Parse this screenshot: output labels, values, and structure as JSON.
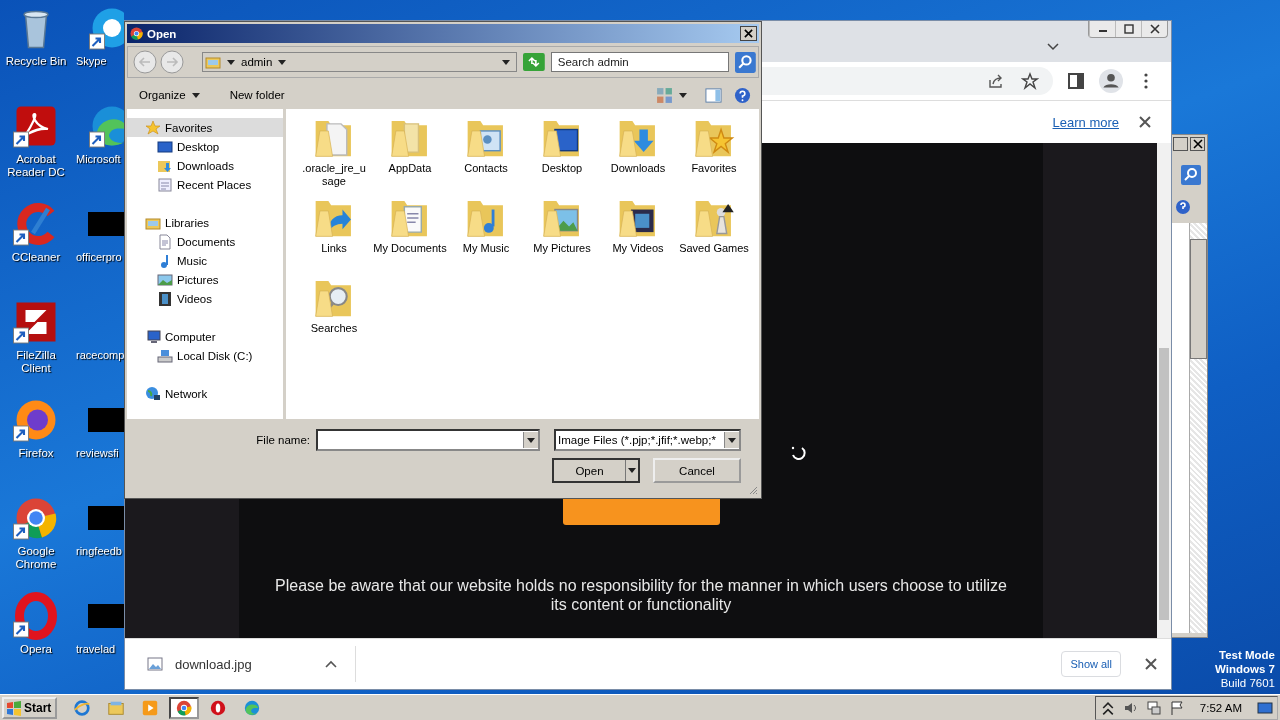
{
  "desktop": {
    "icons": [
      {
        "label": "Recycle Bin",
        "kind": "recycle"
      },
      {
        "label": "Acrobat Reader DC",
        "kind": "acrobat"
      },
      {
        "label": "CCleaner",
        "kind": "ccleaner"
      },
      {
        "label": "FileZilla Client",
        "kind": "filezilla"
      },
      {
        "label": "Firefox",
        "kind": "firefox"
      },
      {
        "label": "Google Chrome",
        "kind": "chrome"
      },
      {
        "label": "Opera",
        "kind": "opera"
      },
      {
        "label": "Skype",
        "kind": "skype"
      },
      {
        "label": "Microsoft",
        "kind": "edge"
      },
      {
        "label": "officerpro",
        "kind": "redacted"
      },
      {
        "label": "racecomp"
      },
      {
        "label": "reviewsfi",
        "kind": "redacted"
      },
      {
        "label": "ringfeedb",
        "kind": "redacted"
      },
      {
        "label": "travelad",
        "kind": "redacted"
      }
    ],
    "test_mode": [
      "Test Mode",
      "Windows 7",
      "Build 7601"
    ]
  },
  "browser": {
    "info_bar": {
      "link": "Learn more"
    },
    "page": {
      "disclaimer": "Please be aware that our website holds no responsibility for the manner in which users choose to utilize its content or functionality"
    },
    "downloads": {
      "file": "download.jpg",
      "show_all": "Show all"
    }
  },
  "dialog": {
    "title": "Open",
    "location": "admin",
    "search": {
      "placeholder": "Search admin"
    },
    "toolbar": [
      "Organize",
      "New folder"
    ],
    "nav_tree": [
      {
        "label": "Favorites",
        "kind": "star",
        "selected": true,
        "children": [
          {
            "label": "Desktop",
            "kind": "desktop",
            "selected": false
          },
          {
            "label": "Downloads",
            "kind": "downloads",
            "selected": false
          },
          {
            "label": "Recent Places",
            "kind": "recent",
            "selected": false
          }
        ]
      },
      {
        "label": "Libraries",
        "kind": "library",
        "selected": false,
        "children": [
          {
            "label": "Documents",
            "kind": "documents",
            "selected": false
          },
          {
            "label": "Music",
            "kind": "music",
            "selected": false
          },
          {
            "label": "Pictures",
            "kind": "pictures",
            "selected": false
          },
          {
            "label": "Videos",
            "kind": "videos",
            "selected": false
          }
        ]
      },
      {
        "label": "Computer",
        "kind": "computer",
        "selected": false,
        "children": [
          {
            "label": "Local Disk (C:)",
            "kind": "disk",
            "selected": false
          }
        ]
      },
      {
        "label": "Network",
        "kind": "network",
        "selected": false
      }
    ],
    "files": [
      {
        "label": ".oracle_jre_u sage",
        "kind": "page"
      },
      {
        "label": "AppData",
        "kind": "plain"
      },
      {
        "label": "Contacts",
        "kind": "contacts"
      },
      {
        "label": "Desktop",
        "kind": "desktop"
      },
      {
        "label": "Downloads",
        "kind": "downloads"
      },
      {
        "label": "Favorites",
        "kind": "star"
      },
      {
        "label": "Links",
        "kind": "links"
      },
      {
        "label": "My Documents",
        "kind": "documents"
      },
      {
        "label": "My Music",
        "kind": "music"
      },
      {
        "label": "My Pictures",
        "kind": "pictures"
      },
      {
        "label": "My Videos",
        "kind": "videos"
      },
      {
        "label": "Saved Games",
        "kind": "games"
      },
      {
        "label": "Searches",
        "kind": "searches"
      }
    ],
    "file_name_label": "File name:",
    "filter": "Image Files (*.pjp;*.jfif;*.webp;*",
    "buttons": [
      "Open",
      "Cancel"
    ]
  },
  "taskbar": {
    "start": "Start",
    "apps": [
      {
        "kind": "ie",
        "selected": false
      },
      {
        "kind": "explorer",
        "selected": false
      },
      {
        "kind": "media",
        "selected": false
      },
      {
        "kind": "chrome",
        "selected": true
      },
      {
        "kind": "opera",
        "selected": false
      },
      {
        "kind": "edge",
        "selected": false
      }
    ],
    "time": "7:52 AM"
  }
}
